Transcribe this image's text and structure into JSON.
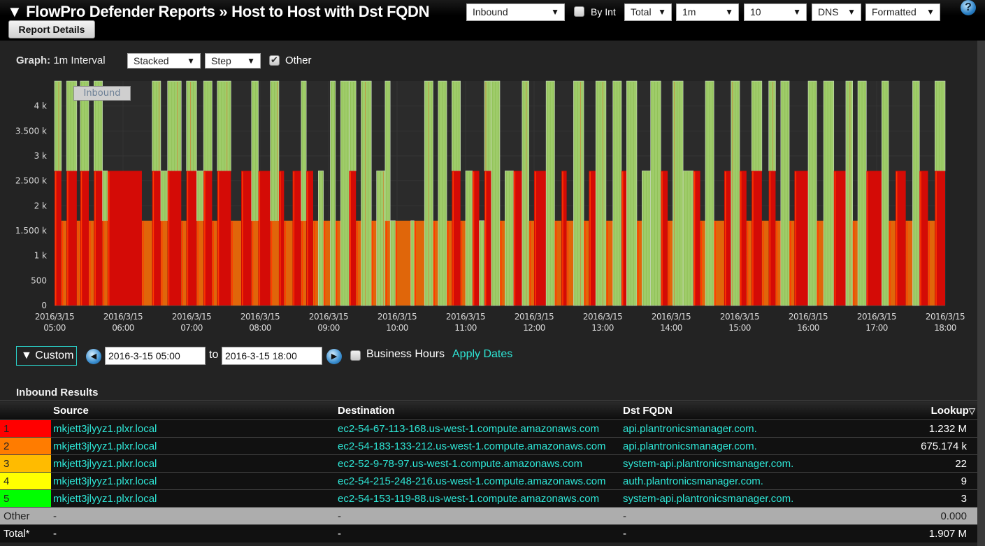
{
  "header": {
    "title": "▼ FlowPro Defender Reports » Host to Host with Dst FQDN",
    "report_details_label": "Report Details",
    "direction_select": "Inbound",
    "by_int_label": "By Int",
    "by_int_checked": false,
    "total_select": "Total",
    "interval_select": "1m",
    "count_select": "10",
    "dns_select": "DNS",
    "format_select": "Formatted",
    "help_icon": "?"
  },
  "graph_controls": {
    "label": "Graph:",
    "interval_text": "1m Interval",
    "mode_select": "Stacked",
    "style_select": "Step",
    "other_label": "Other",
    "other_checked": true
  },
  "chart_data": {
    "type": "area",
    "style": "stacked-step",
    "title": "",
    "legend": [
      "Inbound"
    ],
    "legend_position": "top-left",
    "xlabel": "",
    "ylabel": "",
    "ylim": [
      0,
      4500
    ],
    "y_ticks": [
      {
        "value": 0,
        "label": "0"
      },
      {
        "value": 500,
        "label": "500"
      },
      {
        "value": 1000,
        "label": "1 k"
      },
      {
        "value": 1500,
        "label": "1.500 k"
      },
      {
        "value": 2000,
        "label": "2 k"
      },
      {
        "value": 2500,
        "label": "2.500 k"
      },
      {
        "value": 3000,
        "label": "3 k"
      },
      {
        "value": 3500,
        "label": "3.500 k"
      },
      {
        "value": 4000,
        "label": "4 k"
      }
    ],
    "x_range_minutes": [
      0,
      780
    ],
    "x_ticks": [
      {
        "minute": 0,
        "date": "2016/3/15",
        "time": "05:00"
      },
      {
        "minute": 60,
        "date": "2016/3/15",
        "time": "06:00"
      },
      {
        "minute": 120,
        "date": "2016/3/15",
        "time": "07:00"
      },
      {
        "minute": 180,
        "date": "2016/3/15",
        "time": "08:00"
      },
      {
        "minute": 240,
        "date": "2016/3/15",
        "time": "09:00"
      },
      {
        "minute": 300,
        "date": "2016/3/15",
        "time": "10:00"
      },
      {
        "minute": 360,
        "date": "2016/3/15",
        "time": "11:00"
      },
      {
        "minute": 420,
        "date": "2016/3/15",
        "time": "12:00"
      },
      {
        "minute": 480,
        "date": "2016/3/15",
        "time": "13:00"
      },
      {
        "minute": 540,
        "date": "2016/3/15",
        "time": "14:00"
      },
      {
        "minute": 600,
        "date": "2016/3/15",
        "time": "15:00"
      },
      {
        "minute": 660,
        "date": "2016/3/15",
        "time": "16:00"
      },
      {
        "minute": 720,
        "date": "2016/3/15",
        "time": "17:00"
      },
      {
        "minute": 780,
        "date": "2016/3/15",
        "time": "18:00"
      }
    ],
    "grid": true,
    "series": [
      {
        "name": "1",
        "color": "#d40b06"
      },
      {
        "name": "2",
        "color": "#e0660a"
      },
      {
        "name": "3",
        "color": "#ff3a00"
      },
      {
        "name": "Other",
        "color": "#9fcc6a"
      }
    ],
    "states_note": "Each interval state: [bottom_series, bottom_value, total_value]; 'r'=red series 1 at 2700, 'o'=orange series 2 at 1700, 'g'=other only",
    "state_levels": {
      "r": {
        "series": "1",
        "value": 2700
      },
      "o": {
        "series": "2",
        "value": 1700
      },
      "g": {
        "series": "Other",
        "value": 0
      }
    },
    "segments": [
      [
        "r",
        4,
        4500
      ],
      [
        "o",
        3,
        1700
      ],
      [
        "r",
        6,
        4500
      ],
      [
        "o",
        2,
        1700
      ],
      [
        "r",
        5,
        4500
      ],
      [
        "o",
        3,
        1700
      ],
      [
        "r",
        5,
        4500
      ],
      [
        "o",
        3,
        2700
      ],
      [
        "r",
        20,
        2700
      ],
      [
        "o",
        6,
        1700
      ],
      [
        "r",
        5,
        4500
      ],
      [
        "o",
        4,
        2700
      ],
      [
        "r",
        8,
        4500
      ],
      [
        "o",
        3,
        1700
      ],
      [
        "r",
        6,
        4500
      ],
      [
        "o",
        4,
        2700
      ],
      [
        "r",
        5,
        4500
      ],
      [
        "o",
        3,
        1700
      ],
      [
        "r",
        8,
        4500
      ],
      [
        "o",
        6,
        1700
      ],
      [
        "r",
        6,
        2700
      ],
      [
        "o",
        4,
        4500
      ],
      [
        "r",
        7,
        2700
      ],
      [
        "o",
        5,
        4500
      ],
      [
        "r",
        3,
        2700
      ],
      [
        "o",
        5,
        1700
      ],
      [
        "r",
        5,
        2700
      ],
      [
        "o",
        3,
        4500
      ],
      [
        "r",
        4,
        2700
      ],
      [
        "o",
        3,
        1700
      ],
      [
        "g",
        3,
        2700
      ],
      [
        "o",
        4,
        1700
      ],
      [
        "g",
        3,
        4500
      ],
      [
        "o",
        3,
        1700
      ],
      [
        "g",
        5,
        4500
      ],
      [
        "r",
        4,
        4500
      ],
      [
        "o",
        3,
        1700
      ],
      [
        "g",
        6,
        4500
      ],
      [
        "o",
        3,
        1700
      ],
      [
        "g",
        5,
        2700
      ],
      [
        "o",
        3,
        4500
      ],
      [
        "g",
        3,
        1700
      ],
      [
        "o",
        9,
        1700
      ],
      [
        "g",
        2,
        1700
      ],
      [
        "o",
        6,
        1700
      ],
      [
        "g",
        5,
        4500
      ],
      [
        "o",
        3,
        1700
      ],
      [
        "g",
        5,
        4500
      ],
      [
        "o",
        3,
        1700
      ],
      [
        "r",
        5,
        4500
      ],
      [
        "o",
        3,
        1700
      ],
      [
        "g",
        4,
        2700
      ],
      [
        "r",
        4,
        2700
      ],
      [
        "g",
        3,
        1700
      ],
      [
        "r",
        4,
        4500
      ],
      [
        "g",
        5,
        4500
      ],
      [
        "o",
        3,
        1700
      ],
      [
        "g",
        5,
        2700
      ],
      [
        "r",
        5,
        2700
      ],
      [
        "g",
        4,
        4500
      ],
      [
        "o",
        3,
        1700
      ],
      [
        "r",
        7,
        2700
      ],
      [
        "g",
        5,
        4500
      ],
      [
        "o",
        4,
        1700
      ],
      [
        "r",
        3,
        2700
      ],
      [
        "o",
        4,
        1700
      ],
      [
        "g",
        6,
        4500
      ],
      [
        "o",
        3,
        1700
      ],
      [
        "r",
        4,
        2700
      ],
      [
        "g",
        6,
        4500
      ],
      [
        "o",
        4,
        1700
      ],
      [
        "g",
        5,
        4500
      ],
      [
        "r",
        3,
        2700
      ],
      [
        "g",
        6,
        4500
      ],
      [
        "o",
        3,
        1700
      ],
      [
        "g",
        5,
        2700
      ],
      [
        "g",
        6,
        4500
      ],
      [
        "r",
        4,
        2700
      ],
      [
        "o",
        3,
        1700
      ],
      [
        "g",
        6,
        4500
      ],
      [
        "g",
        6,
        2700
      ],
      [
        "r",
        4,
        2700
      ],
      [
        "o",
        3,
        1700
      ],
      [
        "g",
        5,
        4500
      ],
      [
        "o",
        6,
        1700
      ],
      [
        "r",
        4,
        2700
      ],
      [
        "g",
        5,
        4500
      ],
      [
        "r",
        4,
        2700
      ],
      [
        "o",
        3,
        1700
      ],
      [
        "r",
        6,
        4500
      ],
      [
        "o",
        4,
        1700
      ],
      [
        "r",
        4,
        4500
      ],
      [
        "o",
        3,
        1700
      ],
      [
        "g",
        5,
        4500
      ],
      [
        "o",
        3,
        1700
      ],
      [
        "r",
        8,
        2700
      ],
      [
        "g",
        5,
        4500
      ],
      [
        "o",
        4,
        1700
      ],
      [
        "g",
        6,
        4500
      ],
      [
        "r",
        7,
        2700
      ],
      [
        "g",
        4,
        4500
      ],
      [
        "o",
        3,
        1700
      ],
      [
        "g",
        5,
        4500
      ],
      [
        "r",
        9,
        2700
      ],
      [
        "g",
        4,
        4500
      ],
      [
        "o",
        4,
        1700
      ],
      [
        "r",
        6,
        2700
      ],
      [
        "o",
        4,
        1700
      ],
      [
        "g",
        4,
        4500
      ],
      [
        "r",
        5,
        2700
      ],
      [
        "o",
        4,
        1700
      ],
      [
        "r",
        6,
        4500
      ]
    ]
  },
  "date_controls": {
    "range_preset": "▼ Custom",
    "prev_icon": "◀",
    "start_date": "2016-3-15 05:00",
    "to_label": "to",
    "end_date": "2016-3-15 18:00",
    "next_icon": "▶",
    "business_hours_label": "Business Hours",
    "business_hours_checked": false,
    "apply_label": "Apply Dates"
  },
  "results": {
    "title": "Inbound Results",
    "columns": [
      "",
      "Source",
      "Destination",
      "Dst FQDN",
      "Lookup"
    ],
    "sort_icon": "▽",
    "rows": [
      {
        "rank": "1",
        "color": "#ff0000",
        "source": "mkjett3jlyyz1.plxr.local",
        "destination": "ec2-54-67-113-168.us-west-1.compute.amazonaws.com",
        "fqdn": "api.plantronicsmanager.com.",
        "lookup": "1.232 M"
      },
      {
        "rank": "2",
        "color": "#ff7c00",
        "source": "mkjett3jlyyz1.plxr.local",
        "destination": "ec2-54-183-133-212.us-west-1.compute.amazonaws.com",
        "fqdn": "api.plantronicsmanager.com.",
        "lookup": "675.174 k"
      },
      {
        "rank": "3",
        "color": "#ffbb00",
        "source": "mkjett3jlyyz1.plxr.local",
        "destination": "ec2-52-9-78-97.us-west-1.compute.amazonaws.com",
        "fqdn": "system-api.plantronicsmanager.com.",
        "lookup": "22"
      },
      {
        "rank": "4",
        "color": "#ffff00",
        "source": "mkjett3jlyyz1.plxr.local",
        "destination": "ec2-54-215-248-216.us-west-1.compute.amazonaws.com",
        "fqdn": "auth.plantronicsmanager.com.",
        "lookup": "9"
      },
      {
        "rank": "5",
        "color": "#00ff00",
        "source": "mkjett3jlyyz1.plxr.local",
        "destination": "ec2-54-153-119-88.us-west-1.compute.amazonaws.com",
        "fqdn": "system-api.plantronicsmanager.com.",
        "lookup": "3"
      }
    ],
    "other": {
      "label": "Other",
      "source": "-",
      "destination": "-",
      "fqdn": "-",
      "lookup": "0.000"
    },
    "total": {
      "label": "Total*",
      "source": "-",
      "destination": "-",
      "fqdn": "-",
      "lookup": "1.907 M"
    }
  }
}
